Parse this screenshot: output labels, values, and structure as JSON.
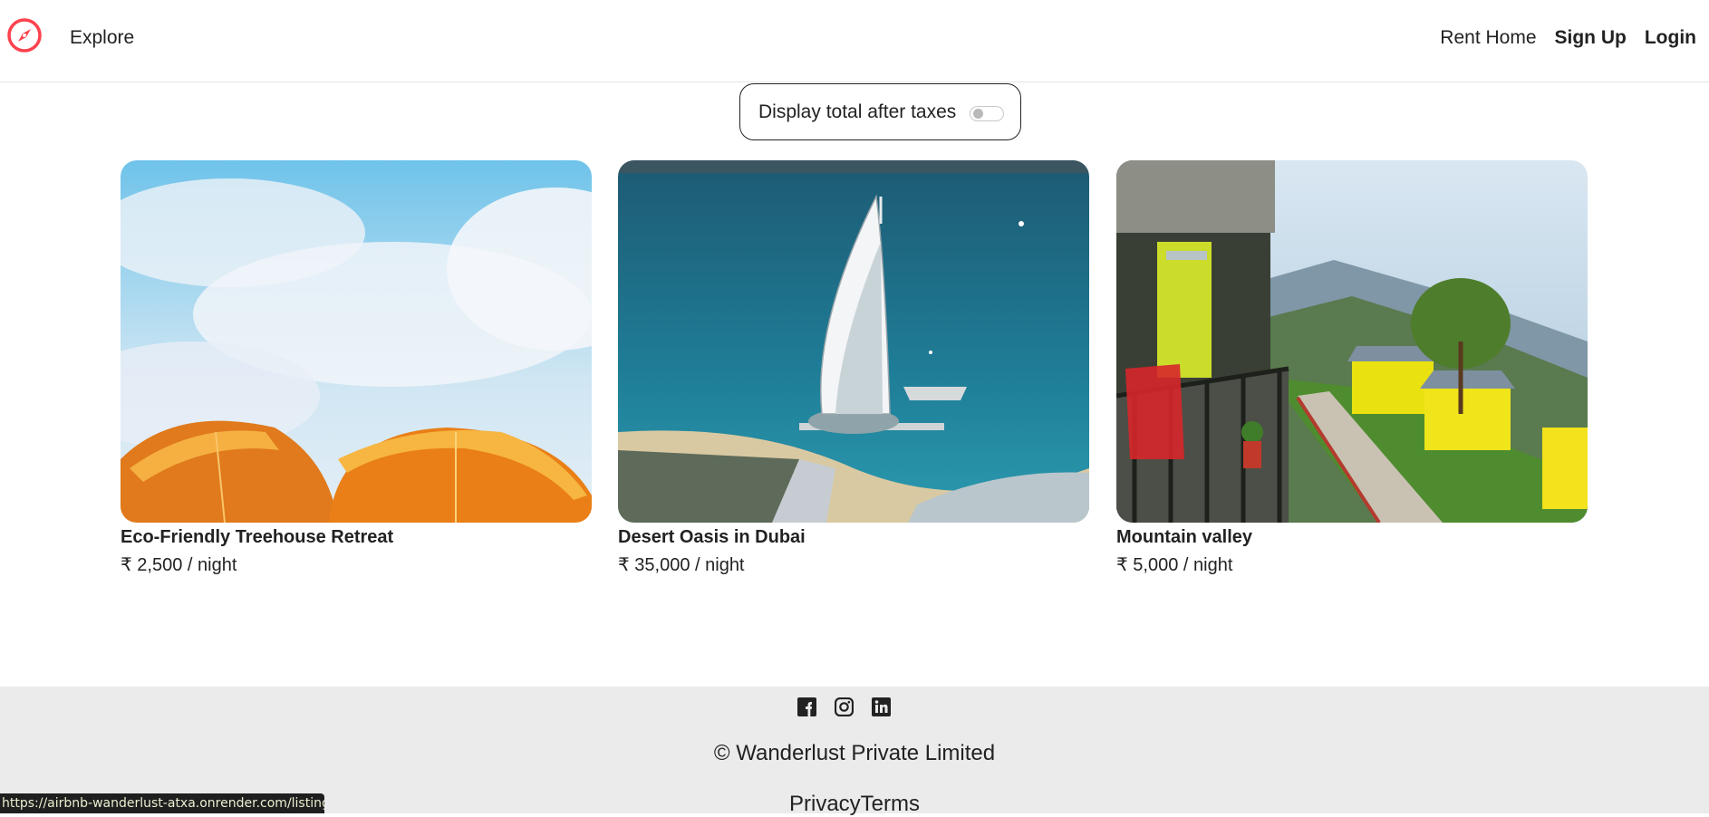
{
  "nav": {
    "logo_icon": "compass-icon",
    "explore": "Explore",
    "rent_home": "Rent Home",
    "sign_up": "Sign Up",
    "login": "Login",
    "brand_color": "#fe424d"
  },
  "tax_toggle": {
    "label": "Display total after taxes",
    "enabled": false
  },
  "listings": [
    {
      "title": "Eco-Friendly Treehouse Retreat",
      "price": "₹ 2,500 / night"
    },
    {
      "title": "Desert Oasis in Dubai",
      "price": "₹ 35,000 / night"
    },
    {
      "title": "Mountain valley",
      "price": "₹ 5,000 / night"
    }
  ],
  "footer": {
    "socials": [
      "facebook-icon",
      "instagram-icon",
      "linkedin-icon"
    ],
    "copyright": "© Wanderlust Private Limited",
    "privacy": "Privacy",
    "terms": "Terms"
  },
  "status_bar": {
    "url": "https://airbnb-wanderlust-atxa.onrender.com/listings"
  }
}
